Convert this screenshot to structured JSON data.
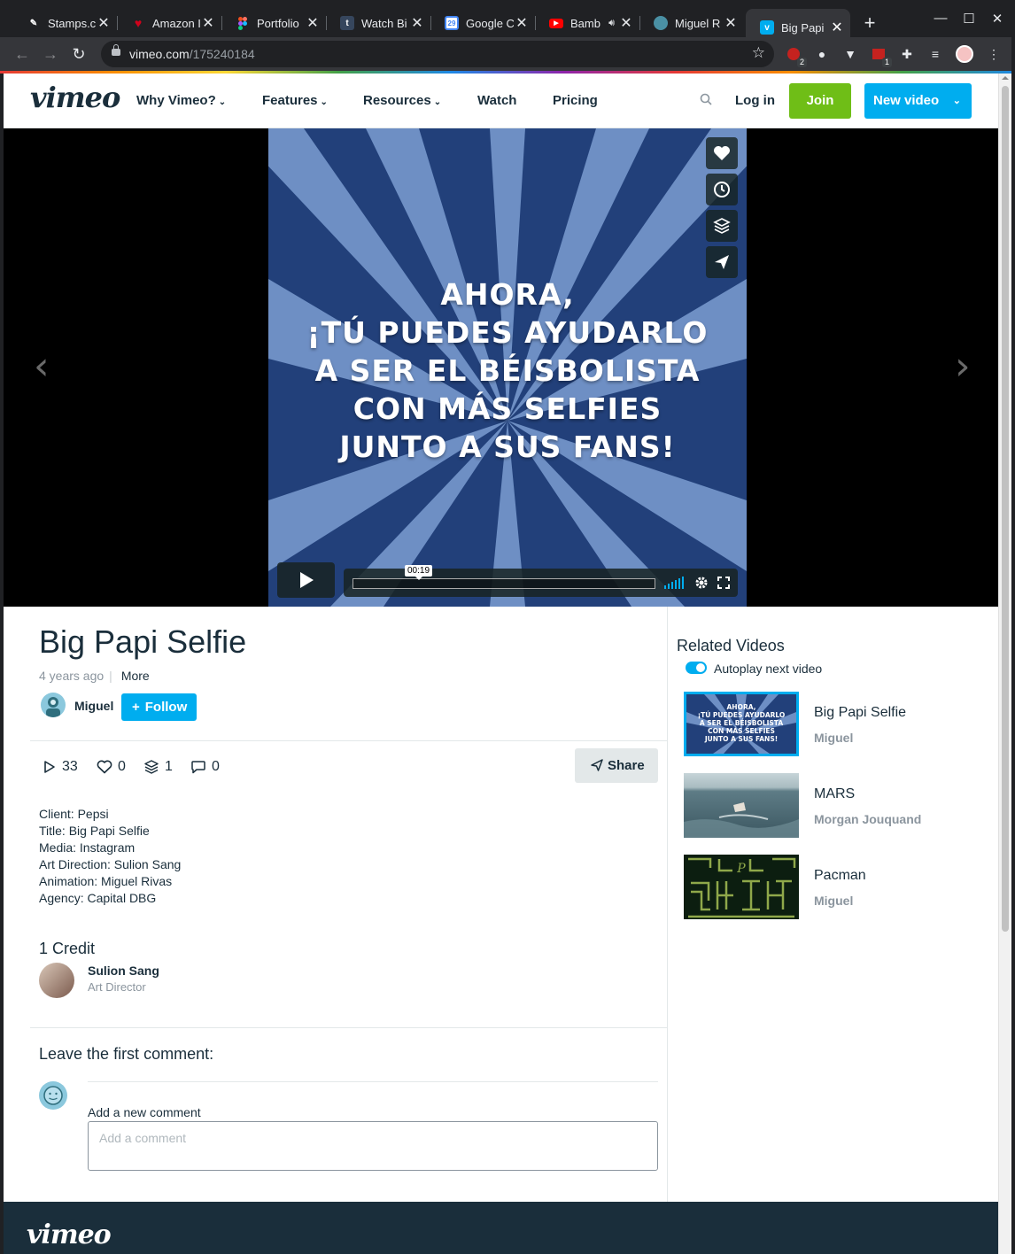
{
  "browser": {
    "tabs": [
      {
        "label": "Stamps.c",
        "favicon": "stamps-favicon",
        "color": "#ffffff"
      },
      {
        "label": "Amazon I",
        "favicon": "amazon-favicon",
        "color": "#d0021b"
      },
      {
        "label": "Portfolio",
        "favicon": "figma-favicon",
        "color": "#f24e1e"
      },
      {
        "label": "Watch Bi",
        "favicon": "tumblr-favicon",
        "color": "#36465d"
      },
      {
        "label": "Google C",
        "favicon": "google-calendar-favicon",
        "color": "#4285f4"
      },
      {
        "label": "Bamb",
        "favicon": "youtube-favicon",
        "color": "#ff0000"
      },
      {
        "label": "Miguel R",
        "favicon": "site-favicon",
        "color": "#4a90a4"
      },
      {
        "label": "Big Papi",
        "favicon": "vimeo-favicon",
        "color": "#00adef",
        "active": true
      }
    ],
    "url_host": "vimeo.com",
    "url_path": "/175240184",
    "extension_badges": {
      "ublock": "2",
      "calendar": "1"
    }
  },
  "header": {
    "logo": "vimeo",
    "nav": [
      "Why Vimeo?",
      "Features",
      "Resources",
      "Watch",
      "Pricing"
    ],
    "login": "Log in",
    "join": "Join",
    "new_video": "New video"
  },
  "player": {
    "headline_lines": [
      "AHORA,",
      "¡TÚ PUEDES AYUDARLO",
      "A SER EL BÉISBOLISTA",
      "CON MÁS SELFIES",
      "JUNTO A SUS FANS!"
    ],
    "timecode": "00:19",
    "progress": 0.0
  },
  "video": {
    "title": "Big Papi Selfie",
    "age": "4 years ago",
    "more": "More",
    "owner": "Miguel",
    "follow": "Follow",
    "stats": {
      "plays": "33",
      "likes": "0",
      "collections": "1",
      "comments": "0"
    },
    "share": "Share",
    "description": [
      "Client: Pepsi",
      "Title: Big Papi Selfie",
      "Media: Instagram",
      "Art Direction: Sulion Sang",
      "Animation: Miguel Rivas",
      "Agency: Capital DBG"
    ]
  },
  "credits": {
    "heading": "1 Credit",
    "items": [
      {
        "name": "Sulion Sang",
        "role": "Art Director"
      }
    ]
  },
  "comments": {
    "heading": "Leave the first comment:",
    "label": "Add a new comment",
    "placeholder": "Add a comment"
  },
  "sidebar": {
    "heading": "Related Videos",
    "autoplay": "Autoplay next video",
    "autoplay_on": true,
    "videos": [
      {
        "title": "Big Papi Selfie",
        "author": "Miguel",
        "thumb_lines": [
          "AHORA,",
          "¡TÚ PUEDES AYUDARLO",
          "A SER EL BÉISBOLISTA",
          "CON MÁS SELFIES",
          "JUNTO A SUS FANS!"
        ]
      },
      {
        "title": "MARS",
        "author": "Morgan Jouquand"
      },
      {
        "title": "Pacman",
        "author": "Miguel"
      }
    ]
  },
  "footer": {
    "logo": "vimeo"
  },
  "colors": {
    "accent": "#00adef",
    "join": "#6fbe17",
    "text": "#1a2e3b",
    "muted": "#8b959e"
  }
}
